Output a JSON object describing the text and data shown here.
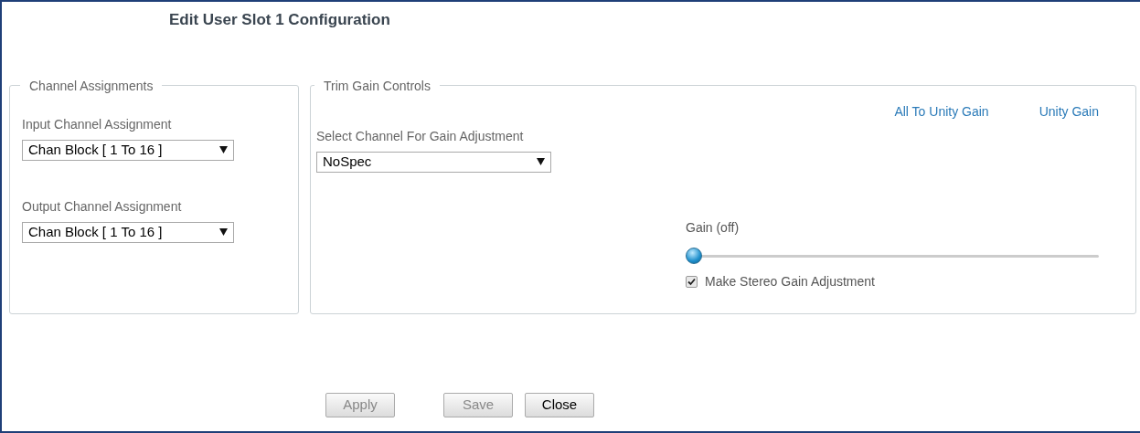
{
  "title": "Edit User Slot 1 Configuration",
  "channel_assignments": {
    "legend": "Channel Assignments",
    "fields": [
      {
        "label": "Input Channel Assignment",
        "value": "Chan Block [ 1 To 16 ]"
      },
      {
        "label": "Output Channel Assignment",
        "value": "Chan Block [ 1 To 16 ]"
      }
    ]
  },
  "trim_gain": {
    "legend": "Trim Gain Controls",
    "links": [
      "All To Unity Gain",
      "Unity Gain"
    ],
    "channel_label": "Select Channel For Gain Adjustment",
    "channel_value": "NoSpec",
    "gain_label": "Gain (off)",
    "gain": {
      "level": 0
    },
    "stereo": {
      "label": "Make Stereo Gain Adjustment",
      "checked": true
    }
  },
  "buttons": [
    {
      "label": "Apply",
      "disabled": true
    },
    {
      "label": "Save",
      "disabled": true
    },
    {
      "label": "Close",
      "disabled": false
    }
  ]
}
